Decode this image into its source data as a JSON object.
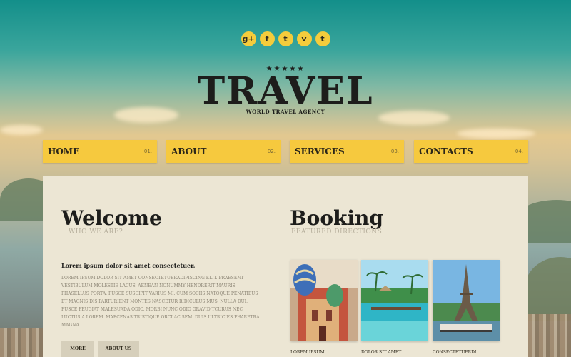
{
  "social": [
    "g+",
    "f",
    "t",
    "v",
    "t"
  ],
  "social_icons": [
    "google-plus-icon",
    "facebook-icon",
    "twitter-icon",
    "vimeo-icon",
    "tumblr-icon"
  ],
  "logo": {
    "stars": "★★★★★",
    "title": "TRAVEL",
    "subtitle": "WORLD TRAVEL AGENCY"
  },
  "nav": [
    {
      "label": "HOME",
      "num": "01."
    },
    {
      "label": "ABOUT",
      "num": "02."
    },
    {
      "label": "SERVICES",
      "num": "03."
    },
    {
      "label": "CONTACTS",
      "num": "04."
    }
  ],
  "welcome": {
    "title": "Welcome",
    "subtitle": "WHO WE ARE?",
    "lead": "Lorem ipsum dolor sit amet consectetuer.",
    "body": "Lorem ipsum dolor sit amet consectetueradipiscing elit. Praesent vestibulum molestie lacus. Aenean nonummy hendrerit mauris. Phasellus porta. Fusce suscipit varius mi. Cum sociis natoque penatibus et magnis dis parturient montes nascetur ridiculus mus. Nulla dui. Fusce feugiat malesuada odio. Morbi nunc odio gravid tcurus nec luctus a lorem. Maecenas tristique orci ac sem. Duis ultricies pharetra magna.",
    "btn_more": "MORE",
    "btn_about": "ABOUT US"
  },
  "booking": {
    "title": "Booking",
    "subtitle": "FEATURED DIRECTIONS",
    "captions": [
      "Lorem ipsum",
      "Dolor sit amet",
      "Consectetuerdi"
    ]
  },
  "colors": {
    "accent": "#f6c93e",
    "panel": "#ece6d4",
    "text": "#1d1d1b"
  }
}
